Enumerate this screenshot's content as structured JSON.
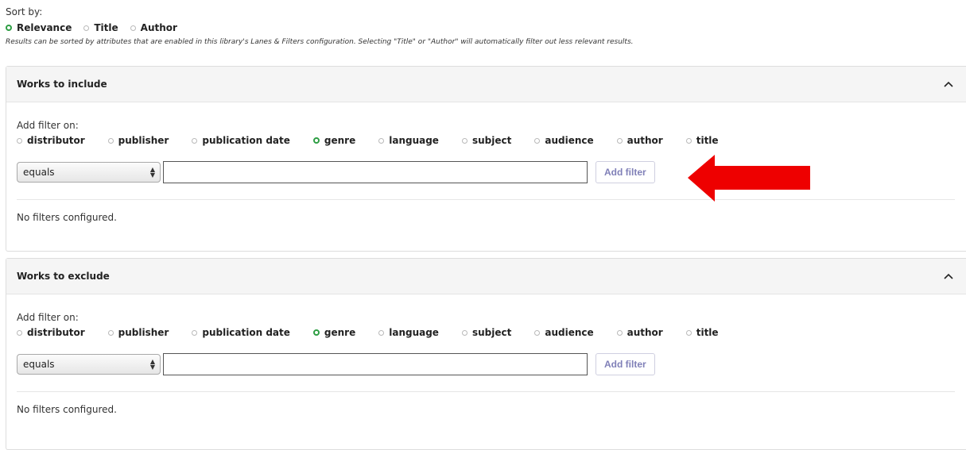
{
  "sort": {
    "label": "Sort by:",
    "options": [
      {
        "label": "Relevance",
        "checked": true
      },
      {
        "label": "Title",
        "checked": false
      },
      {
        "label": "Author",
        "checked": false
      }
    ],
    "note": "Results can be sorted by attributes that are enabled in this library's Lanes & Filters configuration. Selecting \"Title\" or \"Author\" will automatically filter out less relevant results."
  },
  "include": {
    "title": "Works to include",
    "add_label": "Add filter on:",
    "filter_options": [
      {
        "label": "distributor",
        "checked": false
      },
      {
        "label": "publisher",
        "checked": false
      },
      {
        "label": "publication date",
        "checked": false
      },
      {
        "label": "genre",
        "checked": true
      },
      {
        "label": "language",
        "checked": false
      },
      {
        "label": "subject",
        "checked": false
      },
      {
        "label": "audience",
        "checked": false
      },
      {
        "label": "author",
        "checked": false
      },
      {
        "label": "title",
        "checked": false
      }
    ],
    "operator": "equals",
    "value": "",
    "button": "Add filter",
    "empty": "No filters configured."
  },
  "exclude": {
    "title": "Works to exclude",
    "add_label": "Add filter on:",
    "filter_options": [
      {
        "label": "distributor",
        "checked": false
      },
      {
        "label": "publisher",
        "checked": false
      },
      {
        "label": "publication date",
        "checked": false
      },
      {
        "label": "genre",
        "checked": true
      },
      {
        "label": "language",
        "checked": false
      },
      {
        "label": "subject",
        "checked": false
      },
      {
        "label": "audience",
        "checked": false
      },
      {
        "label": "author",
        "checked": false
      },
      {
        "label": "title",
        "checked": false
      }
    ],
    "operator": "equals",
    "value": "",
    "button": "Add filter",
    "empty": "No filters configured."
  },
  "icons": {
    "collapse": "chevron-up-icon",
    "select": "up-down-arrows-icon",
    "annotation": "red-arrow-left-icon"
  },
  "colors": {
    "radio_checked": "#2e9e44",
    "button_text": "#8080b8",
    "annotation": "#ee0000",
    "panel_heading": "#f5f5f5"
  }
}
